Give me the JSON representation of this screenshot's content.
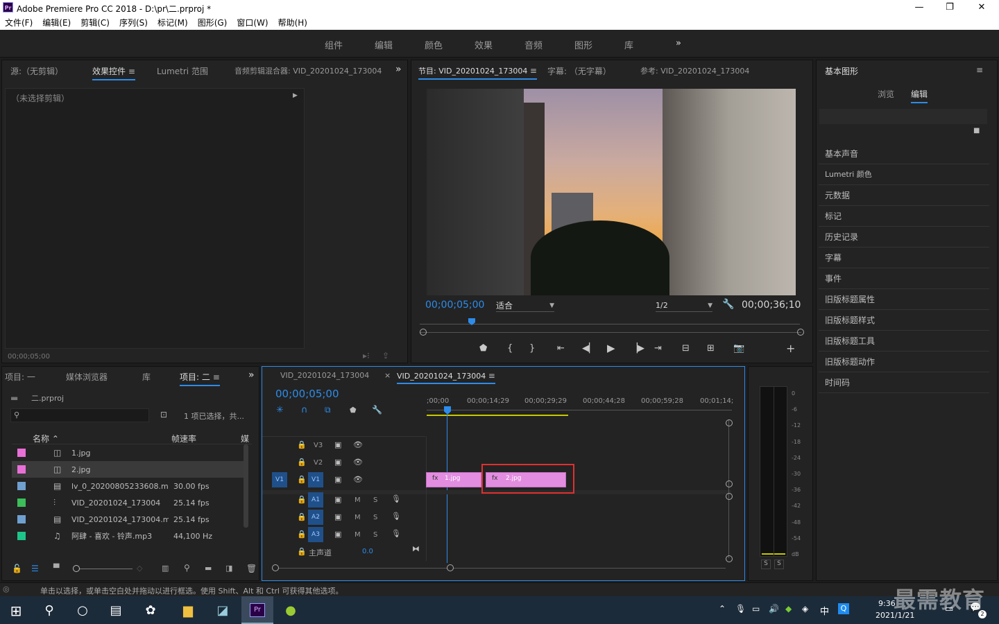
{
  "window": {
    "title": "Adobe Premiere Pro CC 2018 - D:\\pr\\二.prproj *",
    "app_icon": "Pr",
    "controls": [
      "—",
      "❐",
      "✕"
    ]
  },
  "menus": [
    "文件(F)",
    "编辑(E)",
    "剪辑(C)",
    "序列(S)",
    "标记(M)",
    "图形(G)",
    "窗口(W)",
    "帮助(H)"
  ],
  "workspaces": [
    "组件",
    "编辑",
    "颜色",
    "效果",
    "音频",
    "图形",
    "库",
    "»"
  ],
  "source_panel": {
    "tabs": [
      "源:（无剪辑）",
      "效果控件",
      "Lumetri 范围",
      "音频剪辑混合器: VID_20201024_173004"
    ],
    "active": "效果控件",
    "no_clip": "（未选择剪辑）",
    "timecode": "00;00;05;00"
  },
  "program_panel": {
    "tabs": [
      "节目: VID_20201024_173004",
      "字幕: （无字幕）",
      "参考: VID_20201024_173004"
    ],
    "timecode": "00;00;05;00",
    "fit": "适合",
    "resolution": "1/2",
    "duration": "00;00;36;10"
  },
  "essential_graphics": {
    "title": "基本图形",
    "tabs": [
      "浏览",
      "编辑"
    ],
    "active": "编辑",
    "items": [
      "基本声音",
      "Lumetri 颜色",
      "元数据",
      "标记",
      "历史记录",
      "字幕",
      "事件",
      "旧版标题属性",
      "旧版标题样式",
      "旧版标题工具",
      "旧版标题动作",
      "时间码"
    ]
  },
  "project_panel": {
    "tabs": [
      "项目: 一",
      "媒体浏览器",
      "库",
      "项目: 二"
    ],
    "project_file": "二.prproj",
    "selection_info": "1 项已选择，共...",
    "columns": [
      "名称",
      "帧速率",
      "媒"
    ],
    "rows": [
      {
        "name": "1.jpg",
        "fps": "",
        "color": "#e86fd6",
        "icon": "image-icon"
      },
      {
        "name": "2.jpg",
        "fps": "",
        "color": "#e86fd6",
        "icon": "image-icon"
      },
      {
        "name": "lv_0_20200805233608.mp4",
        "fps": "30.00 fps",
        "color": "#6fa0d0",
        "icon": "video-icon"
      },
      {
        "name": "VID_20201024_173004",
        "fps": "25.14 fps",
        "color": "#3cbe5a",
        "icon": "sequence-icon"
      },
      {
        "name": "VID_20201024_173004.mp4",
        "fps": "25.14 fps",
        "color": "#6fa0d0",
        "icon": "video-icon"
      },
      {
        "name": "阿肆 - 喜欢 - 铃声.mp3",
        "fps": "44,100 Hz",
        "color": "#1fc48a",
        "icon": "audio-icon"
      }
    ]
  },
  "timeline": {
    "tabs": [
      "VID_20201024_173004",
      "VID_20201024_173004"
    ],
    "timecode": "00;00;05;00",
    "ruler": [
      ";00;00",
      "00;00;14;29",
      "00;00;29;29",
      "00;00;44;28",
      "00;00;59;28",
      "00;01;14;"
    ],
    "tracks": {
      "video": [
        "V3",
        "V2",
        "V1"
      ],
      "audio": [
        "A1",
        "A2",
        "A3"
      ],
      "source_v": "V1",
      "master": "主声道",
      "master_value": "0.0"
    },
    "clips": [
      "1.jpg",
      "2.jpg"
    ],
    "audio_toggles": [
      "M",
      "S"
    ]
  },
  "meter": {
    "scale": [
      "0",
      "-6",
      "-12",
      "-18",
      "-24",
      "-30",
      "-36",
      "-42",
      "-48",
      "-54",
      "dB"
    ],
    "solo": [
      "S",
      "S"
    ]
  },
  "status": "单击以选择，或单击空白处并拖动以进行框选。使用 Shift、Alt 和 Ctrl 可获得其他选项。",
  "taskbar": {
    "time": "9:36",
    "date": "2021/1/21",
    "ime": "中",
    "notify_count": "2"
  },
  "watermark": "最需教育",
  "colors": {
    "accent": "#2d8ceb",
    "clip": "#e38de0",
    "highlight": "#e03030"
  }
}
